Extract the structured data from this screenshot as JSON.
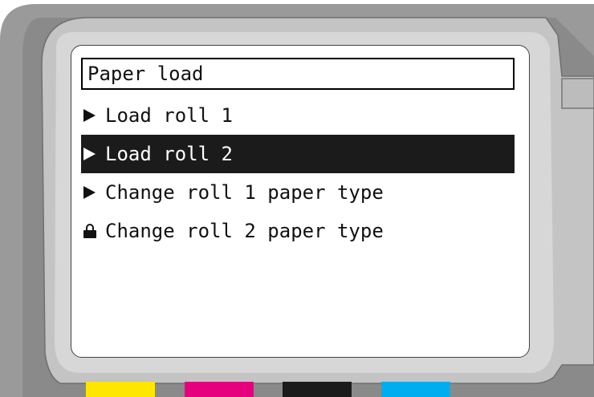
{
  "panel": {
    "title": "Paper load",
    "menu": [
      {
        "label": "Load roll 1",
        "icon": "arrow-right-icon",
        "selected": false
      },
      {
        "label": "Load roll 2",
        "icon": "arrow-right-icon",
        "selected": true
      },
      {
        "label": "Change roll 1 paper type",
        "icon": "arrow-right-icon",
        "selected": false
      },
      {
        "label": "Change roll 2 paper type",
        "icon": "lock-icon",
        "selected": false
      }
    ]
  },
  "ink_colors": {
    "yellow": "#ffe600",
    "magenta": "#e6007e",
    "black": "#1b1b1b",
    "cyan": "#00aeef"
  }
}
